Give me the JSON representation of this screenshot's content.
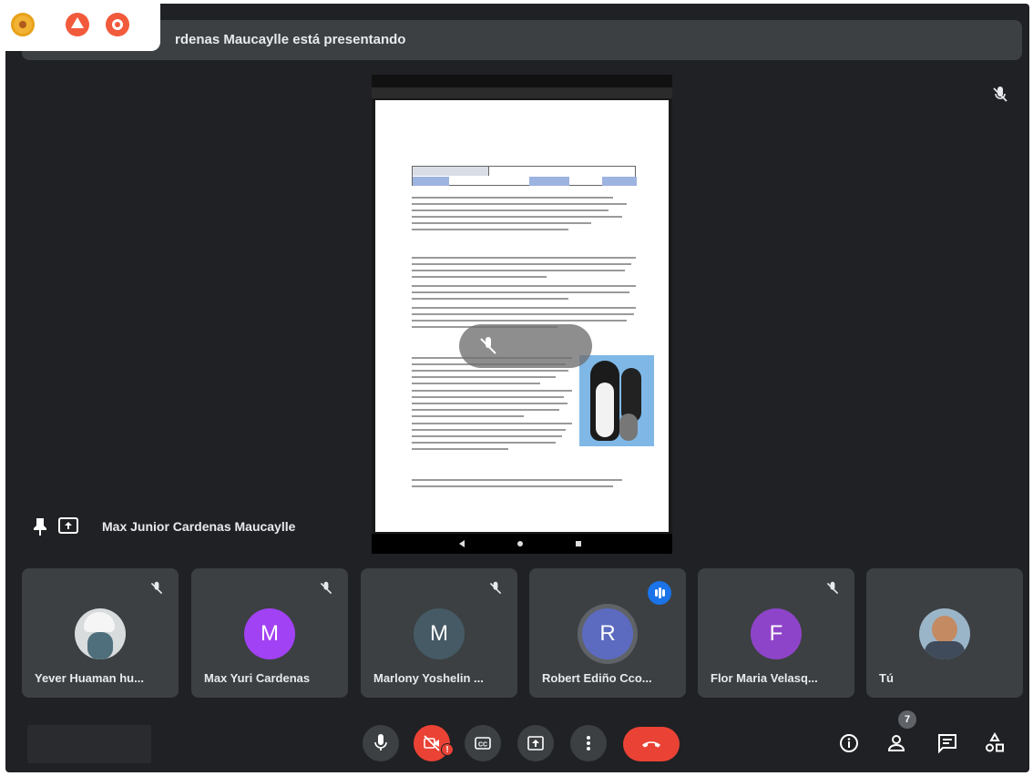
{
  "banner": {
    "text": "rdenas Maucaylle está presentando"
  },
  "presenter": {
    "name": "Max Junior Cardenas Maucaylle"
  },
  "participants": [
    {
      "name": "Yever Huaman hu...",
      "initial": "",
      "color": "",
      "muted": true
    },
    {
      "name": "Max Yuri Cardenas",
      "initial": "M",
      "color": "#a142f4",
      "muted": true
    },
    {
      "name": "Marlony Yoshelin ...",
      "initial": "M",
      "color": "#455a64",
      "muted": true
    },
    {
      "name": "Robert Ediño Cco...",
      "initial": "R",
      "color": "#5c6bc0",
      "muted": false,
      "speaking": true
    },
    {
      "name": "Flor Maria Velasq...",
      "initial": "F",
      "color": "#8e44c8",
      "muted": true
    },
    {
      "name": "Tú",
      "initial": "",
      "color": "",
      "muted": false
    }
  ],
  "controls": {
    "people_count": "7",
    "camera_warning": "!",
    "icons": [
      "mic-icon",
      "camera-off-icon",
      "captions-icon",
      "present-icon",
      "more-icon",
      "end-call-icon",
      "info-icon",
      "people-icon",
      "chat-icon",
      "activities-icon"
    ]
  },
  "colors": {
    "background": "#202124",
    "tile": "#3c4043",
    "danger": "#ea4335",
    "speaking": "#1a73e8"
  }
}
